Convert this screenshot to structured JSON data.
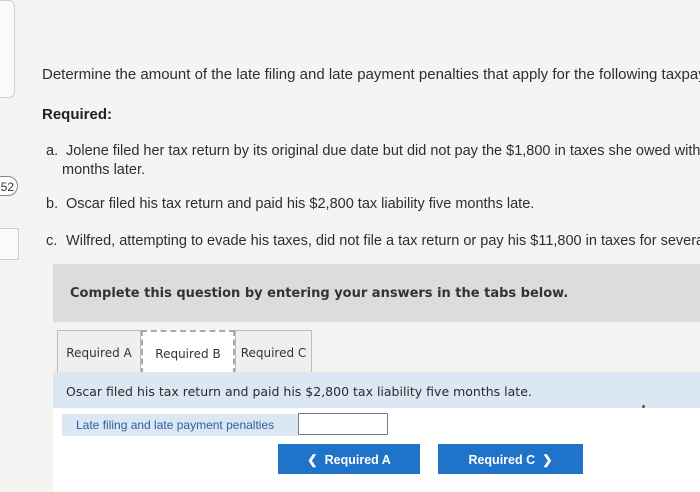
{
  "question_number": "52",
  "intro": "Determine the amount of the late filing and late payment penalties that apply for the following taxpay",
  "required_heading": "Required:",
  "items": [
    {
      "label": "a.",
      "line1": "Jolene filed her tax return by its original due date but did not pay the $1,800 in taxes she owed with",
      "line2": "months later."
    },
    {
      "label": "b.",
      "line1": "Oscar filed his tax return and paid his $2,800 tax liability five months late."
    },
    {
      "label": "c.",
      "line1": "Wilfred, attempting to evade his taxes, did not file a tax return or pay his $11,800 in taxes for several"
    }
  ],
  "instruction": "Complete this question by entering your answers in the tabs below.",
  "tabs": [
    {
      "label": "Required A"
    },
    {
      "label": "Required B"
    },
    {
      "label": "Required C"
    }
  ],
  "active_tab": "Required B",
  "tab_prompt": "Oscar filed his tax return and paid his $2,800 tax liability five months late.",
  "answer_row": {
    "label": "Late filing and late payment penalties",
    "value": ""
  },
  "nav": {
    "prev_label": "Required A",
    "next_label": "Required C",
    "prev_icon": "chevron-left-icon",
    "next_icon": "chevron-right-icon"
  },
  "colors": {
    "primary_button": "#1f73c9",
    "band": "#dbe8f3",
    "panel": "#dcdcdc"
  }
}
